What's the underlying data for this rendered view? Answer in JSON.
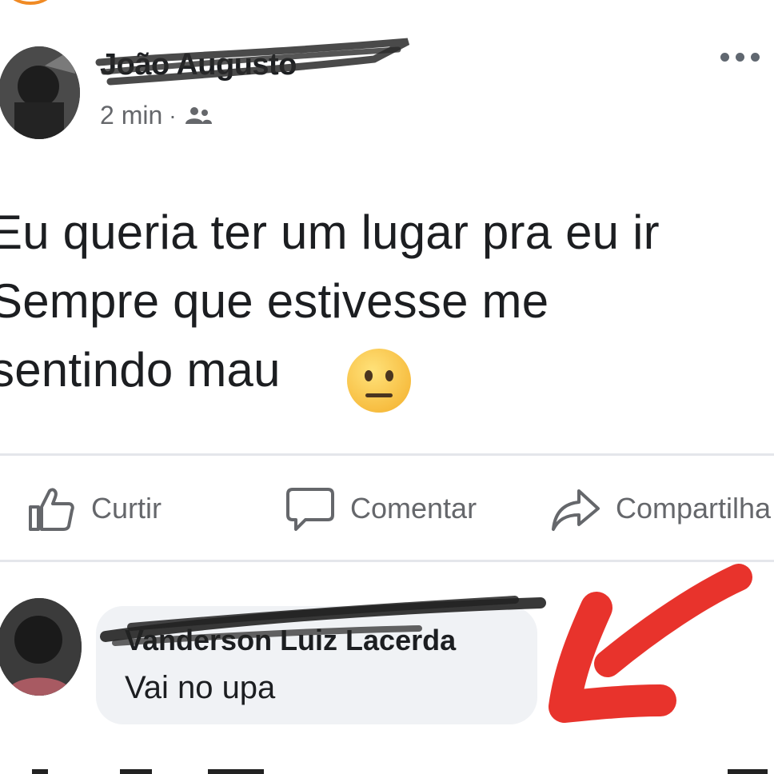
{
  "post": {
    "author": "João Augusto",
    "time": "2 min",
    "separator": "·",
    "audience_icon": "friends-icon",
    "text": "Eu queria ter um lugar pra eu ir\nSempre que estivesse me\nsentindo mau",
    "emoji": "neutral-face-emoji",
    "more_icon": "more-options-icon"
  },
  "actions": {
    "like": "Curtir",
    "comment": "Comentar",
    "share": "Compartilha"
  },
  "comment": {
    "author": "Vanderson Luiz Lacerda",
    "text": "Vai no upa"
  },
  "colors": {
    "annotation_arrow": "#e8332c",
    "secondary_text": "#65676b",
    "bubble": "#f0f2f5"
  }
}
